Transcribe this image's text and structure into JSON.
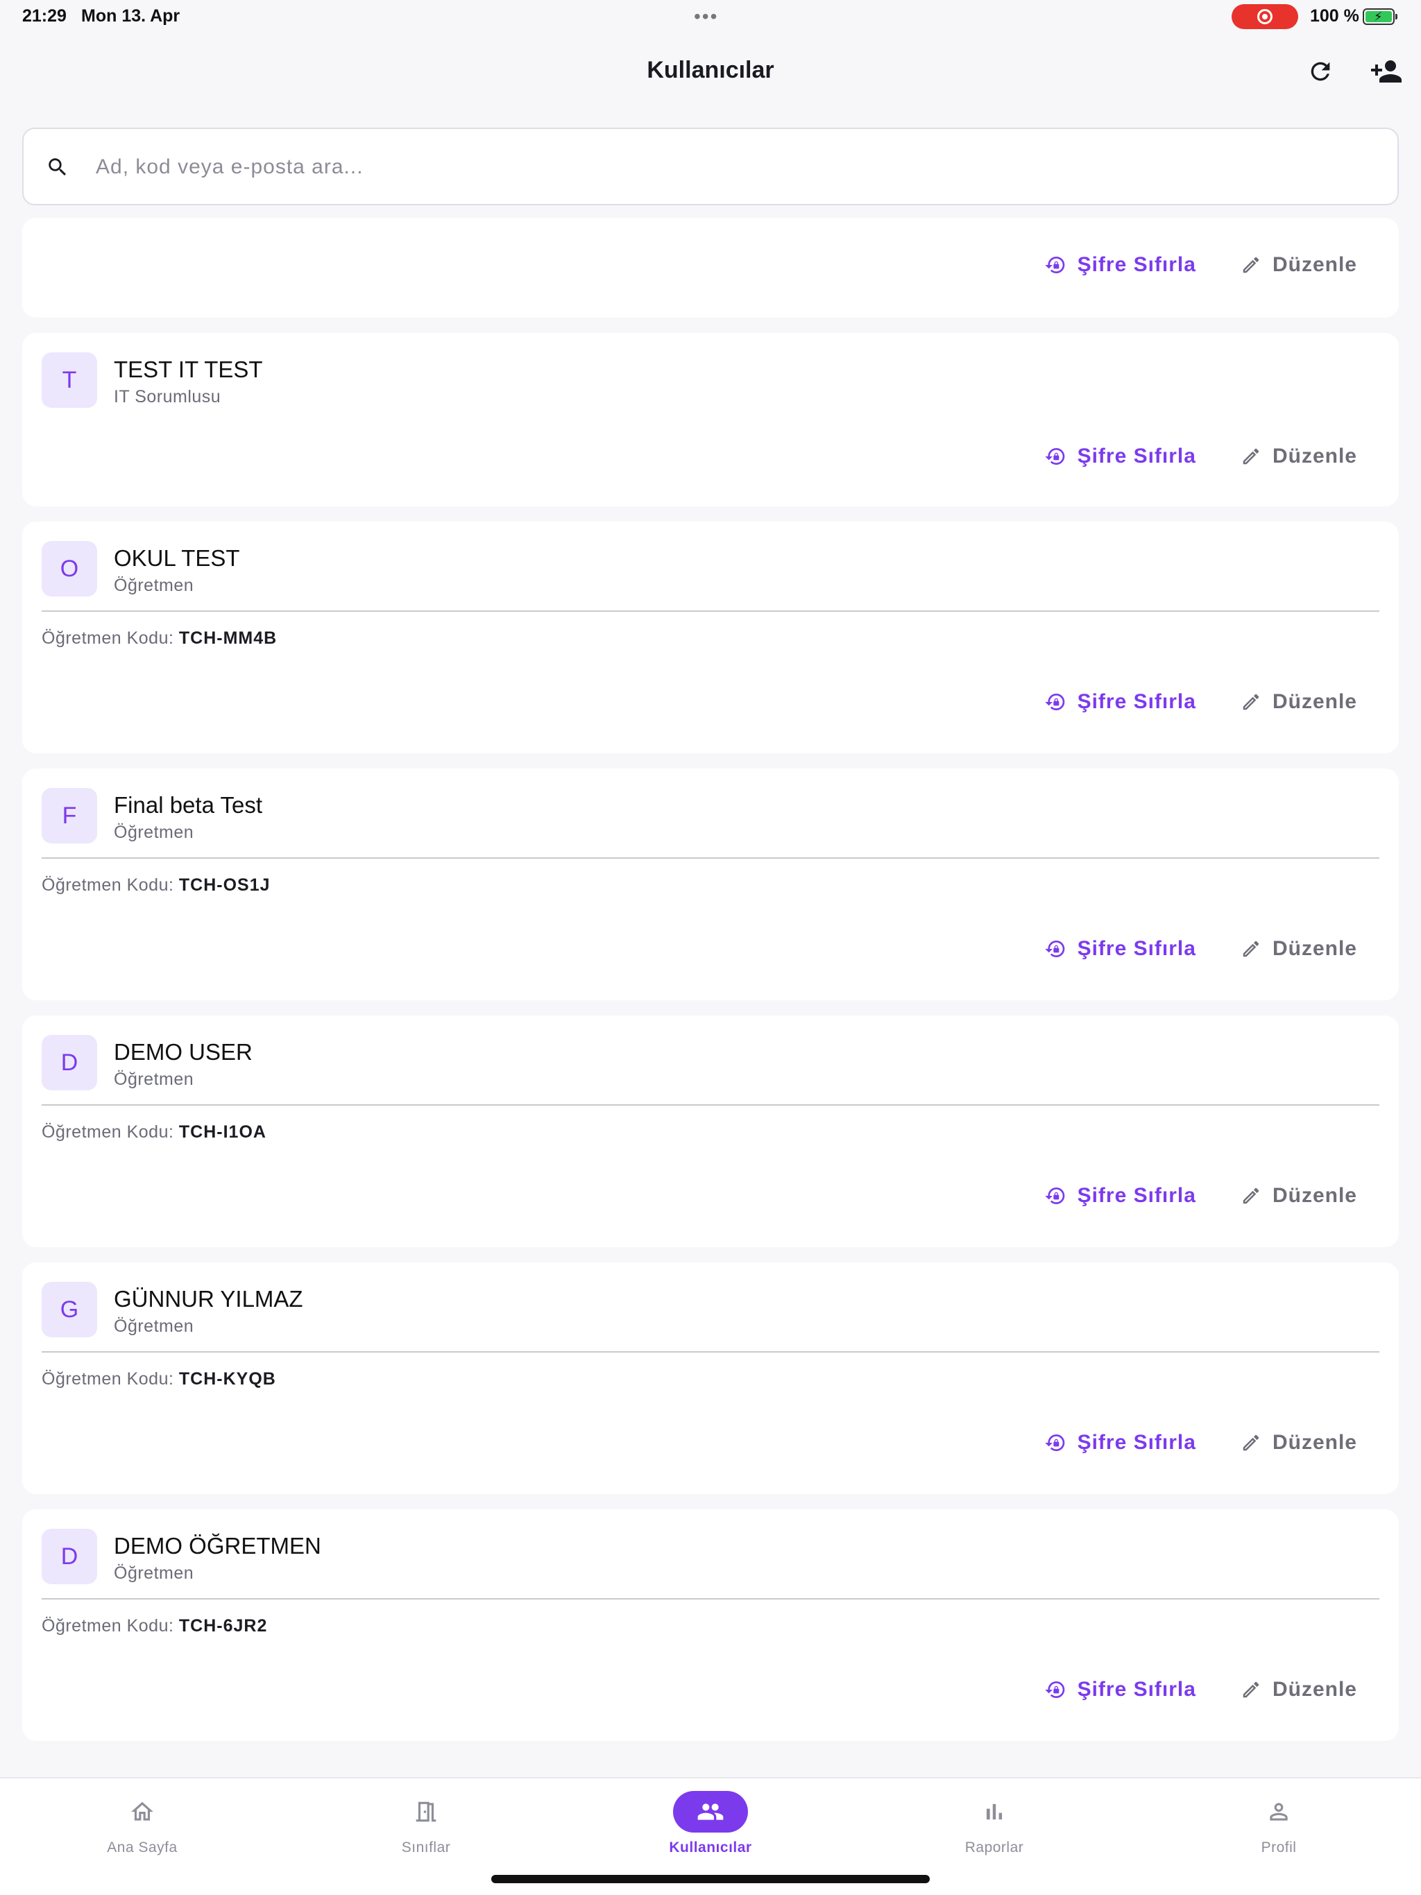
{
  "status_bar": {
    "time": "21:29",
    "date": "Mon 13. Apr",
    "battery": "100 %"
  },
  "header": {
    "title": "Kullanıcılar"
  },
  "search": {
    "placeholder": "Ad, kod veya e-posta ara..."
  },
  "actions": {
    "reset_label": "Şifre Sıfırla",
    "edit_label": "Düzenle"
  },
  "code_label": "Öğretmen Kodu:",
  "users": [
    {
      "initial": "T",
      "name": "TEST IT TEST",
      "role": "IT Sorumlusu"
    },
    {
      "initial": "O",
      "name": "OKUL TEST",
      "role": "Öğretmen",
      "code": "TCH-MM4B"
    },
    {
      "initial": "F",
      "name": "Final beta Test",
      "role": "Öğretmen",
      "code": "TCH-OS1J"
    },
    {
      "initial": "D",
      "name": "DEMO USER",
      "role": "Öğretmen",
      "code": "TCH-I1OA"
    },
    {
      "initial": "G",
      "name": "GÜNNUR YILMAZ",
      "role": "Öğretmen",
      "code": "TCH-KYQB"
    },
    {
      "initial": "D",
      "name": "DEMO ÖĞRETMEN",
      "role": "Öğretmen",
      "code": "TCH-6JR2"
    }
  ],
  "nav": {
    "home": "Ana Sayfa",
    "classes": "Sınıflar",
    "users": "Kullanıcılar",
    "reports": "Raporlar",
    "profile": "Profil"
  },
  "colors": {
    "accent": "#7c3aed",
    "avatar_bg": "#ece7fd",
    "record": "#e7332b",
    "battery": "#33c759"
  }
}
